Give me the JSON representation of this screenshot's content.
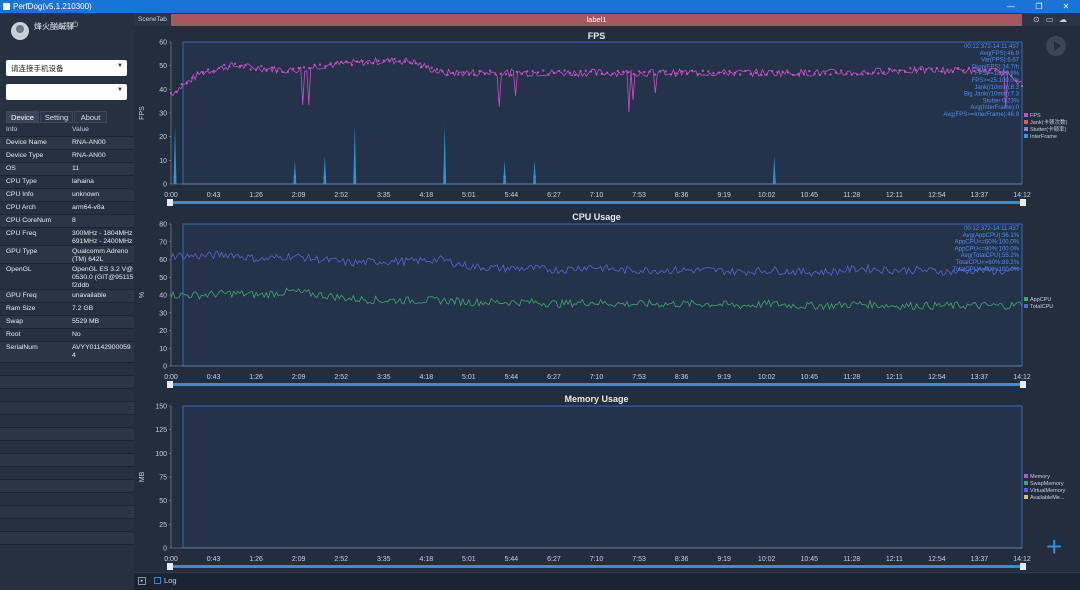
{
  "window": {
    "title": "PerfDog(v5.1.210300)"
  },
  "user": {
    "name": "烽火酗鹹驛"
  },
  "sidebar": {
    "device_select": "请连接手机设备",
    "app_select": "",
    "tabs": [
      "Device",
      "Setting",
      "About"
    ],
    "table_header": {
      "key": "Info",
      "value": "Value"
    },
    "rows": [
      {
        "key": "Device Name",
        "value": "RNA-AN00"
      },
      {
        "key": "Device Type",
        "value": "RNA-AN00"
      },
      {
        "key": "OS",
        "value": "11"
      },
      {
        "key": "CPU Type",
        "value": "lahaina"
      },
      {
        "key": "CPU Info",
        "value": "unknown"
      },
      {
        "key": "CPU Arch",
        "value": "arm64-v8a"
      },
      {
        "key": "CPU CoreNum",
        "value": "8"
      },
      {
        "key": "CPU Freq",
        "value": "300MHz - 1804MHz 691MHz - 2400MHz"
      },
      {
        "key": "GPU Type",
        "value": "Qualcomm Adreno (TM) 642L"
      },
      {
        "key": "OpenGL",
        "value": "OpenGL ES 3.2 V@0530.0 (GIT@95115f2ddb"
      },
      {
        "key": "GPU Freq",
        "value": "unavailable"
      },
      {
        "key": "Ram Size",
        "value": "7.2 GB"
      },
      {
        "key": "Swap",
        "value": "5529 MB"
      },
      {
        "key": "Root",
        "value": "No"
      },
      {
        "key": "SerialNum",
        "value": "AVYY011429000594"
      }
    ]
  },
  "scene": {
    "tab_label": "SceneTab",
    "label": "label1"
  },
  "bottom": {
    "log_label": "Log"
  },
  "colors": {
    "fps": "#c94fc8",
    "jank": "#e05a5a",
    "interframe": "#2f9be6",
    "app_cpu": "#3ea86a",
    "total_cpu": "#5b63d6",
    "plot_border": "#3a78d8",
    "scrollbar": "#2d8fe6"
  },
  "icons": [
    "location-icon",
    "folder-icon",
    "cloud-icon",
    "play-icon",
    "plus-icon"
  ],
  "chart_data": [
    {
      "type": "line",
      "title": "FPS",
      "ylabel": "FPS",
      "ylim": [
        0,
        60
      ],
      "yticks": [
        0,
        10,
        20,
        30,
        40,
        50,
        60
      ],
      "xticks": [
        "0:00",
        "0:43",
        "1:26",
        "2:09",
        "2:52",
        "3:35",
        "4:18",
        "5:01",
        "5:44",
        "6:27",
        "7:10",
        "7:53",
        "8:36",
        "9:19",
        "10:02",
        "10:45",
        "11:28",
        "12:11",
        "12:54",
        "13:37",
        "14:12"
      ],
      "x": [
        0,
        0.5,
        1,
        1.5,
        2,
        2.5,
        3,
        3.5,
        4,
        4.5,
        5,
        5.5,
        6,
        6.5,
        7,
        7.5,
        8,
        8.5,
        9,
        9.5,
        10,
        10.5,
        11,
        11.5,
        12,
        12.5,
        13,
        13.5,
        14,
        14.2
      ],
      "series": [
        {
          "name": "FPS",
          "values": [
            38,
            47,
            50,
            49,
            48,
            50,
            51,
            52,
            52,
            47,
            47,
            47,
            47,
            47,
            47,
            47,
            47,
            47,
            47,
            47,
            47,
            47,
            47,
            47,
            48,
            48,
            48,
            48,
            47,
            42
          ]
        },
        {
          "name": "Jank(卡顿次数)",
          "values": [
            3,
            0,
            0,
            0,
            3,
            3,
            3,
            0,
            0,
            3,
            0,
            3,
            3,
            0,
            0,
            0,
            0,
            0,
            0,
            0,
            0,
            0,
            0,
            0,
            0,
            0,
            0,
            0,
            0,
            0
          ]
        },
        {
          "name": "Stutter(卡顿率)",
          "values": [
            0,
            0,
            0,
            0,
            0,
            0,
            0,
            0,
            0,
            0,
            0,
            0,
            0,
            0,
            0,
            0,
            0,
            0,
            0,
            0,
            0,
            0,
            0,
            0,
            0,
            0,
            0,
            0,
            0,
            0
          ]
        },
        {
          "name": "InterFrame",
          "values": [
            25,
            0,
            0,
            0,
            10,
            12,
            25,
            0,
            0,
            25,
            0,
            10,
            10,
            0,
            0,
            0,
            0,
            0,
            0,
            0,
            12,
            0,
            0,
            0,
            0,
            0,
            0,
            0,
            0,
            0
          ]
        }
      ],
      "annotations": [
        "00:12:372-14:11:437",
        "Avg(FPS):46.9",
        "Var(FPS):6.67",
        "Drop(FPS):34.7/h",
        "FPS>=18:99.8%",
        "FPS>=25:100.0%",
        "Jank(/10min):8.3",
        "Big Jank(/10min):7.3",
        "Stutter:0.23%",
        "Avg(InterFrame):0",
        "Avg(FPS>=InterFrame):46.9"
      ]
    },
    {
      "type": "line",
      "title": "CPU Usage",
      "ylabel": "%",
      "ylim": [
        0,
        80
      ],
      "yticks": [
        0,
        10,
        20,
        30,
        40,
        50,
        60,
        70,
        80
      ],
      "xticks": [
        "0:00",
        "0:43",
        "1:26",
        "2:09",
        "2:52",
        "3:35",
        "4:18",
        "5:01",
        "5:44",
        "6:27",
        "7:10",
        "7:53",
        "8:36",
        "9:19",
        "10:02",
        "10:45",
        "11:28",
        "12:11",
        "12:54",
        "13:37",
        "14:12"
      ],
      "x": [
        0,
        0.5,
        1,
        1.5,
        2,
        2.5,
        3,
        3.5,
        4,
        4.5,
        5,
        5.5,
        6,
        6.5,
        7,
        7.5,
        8,
        8.5,
        9,
        9.5,
        10,
        10.5,
        11,
        11.5,
        12,
        12.5,
        13,
        13.5,
        14,
        14.2
      ],
      "series": [
        {
          "name": "AppCPU",
          "values": [
            40,
            40,
            41,
            40,
            42,
            40,
            38,
            37,
            37,
            37,
            36,
            36,
            36,
            35,
            36,
            35,
            35,
            35,
            35,
            34,
            35,
            34,
            34,
            35,
            34,
            34,
            34,
            34,
            34,
            35
          ]
        },
        {
          "name": "TotalCPU",
          "values": [
            62,
            62,
            63,
            60,
            62,
            60,
            58,
            59,
            59,
            60,
            56,
            55,
            55,
            54,
            56,
            54,
            54,
            54,
            54,
            53,
            54,
            53,
            53,
            55,
            54,
            54,
            53,
            54,
            53,
            55
          ]
        }
      ],
      "annotations": [
        "00:12:372-14:11:437",
        "Avg(AppCPU):36.1%",
        "AppCPU<=60%:100.0%",
        "AppCPU<=80%:100.0%",
        "Avg(TotalCPU):55.2%",
        "TotalCPU<=60%:89.2%",
        "TotalCPU<=80%:100.0%"
      ]
    },
    {
      "type": "line",
      "title": "Memory Usage",
      "ylabel": "MB",
      "ylim": [
        0,
        150
      ],
      "yticks": [
        0,
        25,
        50,
        75,
        100,
        125,
        150
      ],
      "xticks": [
        "0:00",
        "0:43",
        "1:26",
        "2:09",
        "2:52",
        "3:35",
        "4:18",
        "5:01",
        "5:44",
        "6:27",
        "7:10",
        "7:53",
        "8:36",
        "9:19",
        "10:02",
        "10:45",
        "11:28",
        "12:11",
        "12:54",
        "13:37",
        "14:12"
      ],
      "series": [
        {
          "name": "Memory",
          "values": []
        },
        {
          "name": "SwapMemory",
          "values": []
        },
        {
          "name": "VirtualMemory",
          "values": []
        },
        {
          "name": "AvailableMe...",
          "values": []
        }
      ]
    }
  ]
}
